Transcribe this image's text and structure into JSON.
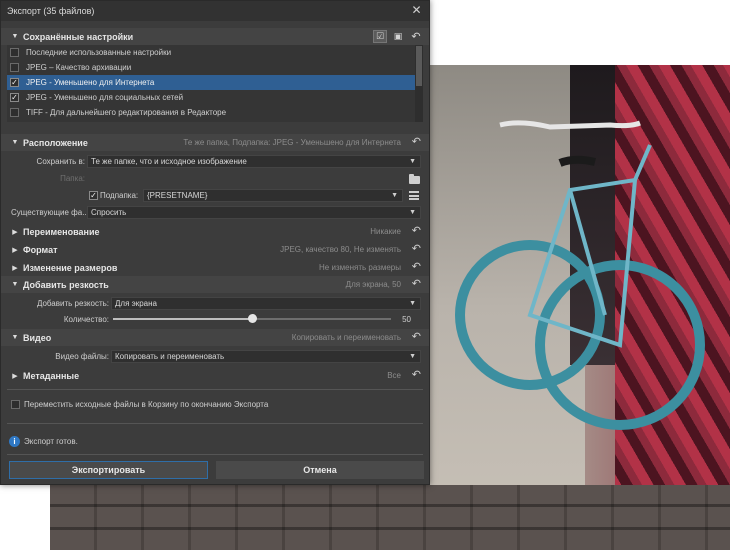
{
  "window": {
    "title": "Экспорт (35 файлов)"
  },
  "saved_settings": {
    "title": "Сохранённые настройки",
    "presets": [
      {
        "label": "Последние использованные настройки",
        "checked": false,
        "selected": false
      },
      {
        "label": "JPEG – Качество архивации",
        "checked": false,
        "selected": false
      },
      {
        "label": "JPEG - Уменьшено для Интернета",
        "checked": true,
        "selected": true
      },
      {
        "label": "JPEG - Уменьшено для социальных сетей",
        "checked": true,
        "selected": false
      },
      {
        "label": "TIFF - Для дальнейшего редактирования в Редакторе",
        "checked": false,
        "selected": false
      }
    ]
  },
  "location": {
    "title": "Расположение",
    "summary": "Те же папка, Подпапка: JPEG - Уменьшено для Интернета",
    "save_to_label": "Сохранить в:",
    "save_to_value": "Те же папке, что и исходное изображение",
    "folder_label": "Папка:",
    "subfolder_label": "Подпапка:",
    "subfolder_value": "{PRESETNAME}",
    "existing_label": "Существующие фа...",
    "existing_value": "Спросить"
  },
  "rename": {
    "title": "Переименование",
    "summary": "Никакие"
  },
  "format": {
    "title": "Формат",
    "summary": "JPEG, качество 80, Не изменять"
  },
  "resize": {
    "title": "Изменение размеров",
    "summary": "Не изменять размеры"
  },
  "sharpen": {
    "title": "Добавить резкость",
    "summary": "Для экрана, 50",
    "add_label": "Добавить резкость:",
    "add_value": "Для экрана",
    "amount_label": "Количество:",
    "amount_value": "50",
    "amount_fraction": 0.5
  },
  "video": {
    "title": "Видео",
    "summary": "Копировать и переименовать",
    "files_label": "Видео файлы:",
    "files_value": "Копировать и переименовать"
  },
  "metadata": {
    "title": "Метаданные",
    "summary": "Все"
  },
  "trash_option": "Переместить исходные файлы в Корзину по окончанию Экспорта",
  "status": "Экспорт готов.",
  "buttons": {
    "export": "Экспортировать",
    "cancel": "Отмена"
  },
  "colors": {
    "accent": "#2f5f93",
    "dialog_bg": "#3c3c3c",
    "info": "#2f78c4"
  }
}
